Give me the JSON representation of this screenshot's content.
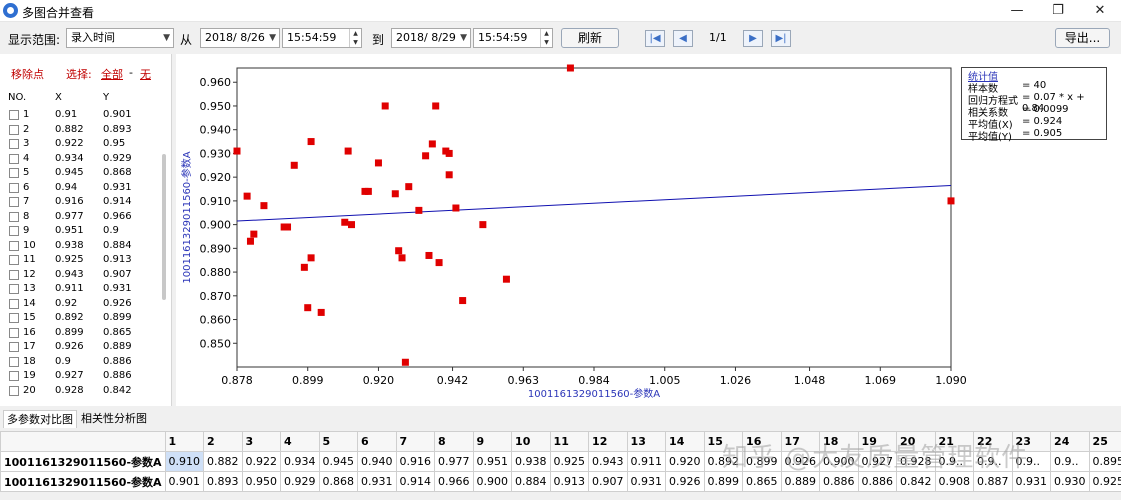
{
  "window": {
    "title": "多图合并查看",
    "controls": [
      "—",
      "❐",
      "✕"
    ]
  },
  "toolbar": {
    "range_label": "显示范围:",
    "range_value": "录入时间",
    "from_label": "从",
    "from_date": "2018/ 8/26",
    "from_time": "15:54:59",
    "to_label": "到",
    "to_date": "2018/ 8/29",
    "to_time": "15:54:59",
    "refresh_label": "刷新",
    "page": "1/1",
    "export_label": "导出..."
  },
  "left_panel": {
    "remove_label": "移除点",
    "select_label": "选择:",
    "all_label": "全部",
    "dash": "-",
    "none_label": "无",
    "columns": [
      "NO.",
      "X",
      "Y"
    ],
    "rows": [
      [
        "1",
        "0.91",
        "0.901"
      ],
      [
        "2",
        "0.882",
        "0.893"
      ],
      [
        "3",
        "0.922",
        "0.95"
      ],
      [
        "4",
        "0.934",
        "0.929"
      ],
      [
        "5",
        "0.945",
        "0.868"
      ],
      [
        "6",
        "0.94",
        "0.931"
      ],
      [
        "7",
        "0.916",
        "0.914"
      ],
      [
        "8",
        "0.977",
        "0.966"
      ],
      [
        "9",
        "0.951",
        "0.9"
      ],
      [
        "10",
        "0.938",
        "0.884"
      ],
      [
        "11",
        "0.925",
        "0.913"
      ],
      [
        "12",
        "0.943",
        "0.907"
      ],
      [
        "13",
        "0.911",
        "0.931"
      ],
      [
        "14",
        "0.92",
        "0.926"
      ],
      [
        "15",
        "0.892",
        "0.899"
      ],
      [
        "16",
        "0.899",
        "0.865"
      ],
      [
        "17",
        "0.926",
        "0.889"
      ],
      [
        "18",
        "0.9",
        "0.886"
      ],
      [
        "19",
        "0.927",
        "0.886"
      ],
      [
        "20",
        "0.928",
        "0.842"
      ]
    ]
  },
  "stats": {
    "title": "统计值",
    "rows": [
      [
        "样本数",
        "= 40"
      ],
      [
        "回归方程式",
        "= 0.07 * x + 0.84"
      ],
      [
        "相关系数",
        "= 0.0099"
      ],
      [
        "平均值(X)",
        "= 0.924"
      ],
      [
        "平均值(Y)",
        "= 0.905"
      ]
    ]
  },
  "tabs": [
    "多参数对比图",
    "相关性分析图"
  ],
  "table": {
    "headers": [
      "1",
      "2",
      "3",
      "4",
      "5",
      "6",
      "7",
      "8",
      "9",
      "10",
      "11",
      "12",
      "13",
      "14",
      "15",
      "16",
      "17",
      "18",
      "19",
      "20",
      "21",
      "22",
      "23",
      "24",
      "25"
    ],
    "rows": [
      {
        "name": "1001161329011560-参数A",
        "values": [
          "0.910",
          "0.882",
          "0.922",
          "0.934",
          "0.945",
          "0.940",
          "0.916",
          "0.977",
          "0.951",
          "0.938",
          "0.925",
          "0.943",
          "0.911",
          "0.920",
          "0.892",
          "0.899",
          "0.926",
          "0.900",
          "0.927",
          "0.928",
          "0.9..",
          "0.9..",
          "0.9..",
          "0.9..",
          "0.895"
        ]
      },
      {
        "name": "1001161329011560-参数A",
        "values": [
          "0.901",
          "0.893",
          "0.950",
          "0.929",
          "0.868",
          "0.931",
          "0.914",
          "0.966",
          "0.900",
          "0.884",
          "0.913",
          "0.907",
          "0.931",
          "0.926",
          "0.899",
          "0.865",
          "0.889",
          "0.886",
          "0.886",
          "0.842",
          "0.908",
          "0.887",
          "0.931",
          "0.930",
          "0.925"
        ]
      }
    ]
  },
  "watermark": "知乎 @大友质量管理软件",
  "colors": {
    "points": "#e00000",
    "regression": "#1010b0",
    "axis_label": "#2b35b8"
  },
  "chart_data": {
    "type": "scatter",
    "xlabel": "1001161329011560-参数A",
    "ylabel": "1001161329011560-参数A",
    "xlim": [
      0.878,
      1.09
    ],
    "ylim": [
      0.84,
      0.966
    ],
    "x_ticks": [
      "0.878",
      "0.899",
      "0.920",
      "0.942",
      "0.963",
      "0.984",
      "1.005",
      "1.026",
      "1.048",
      "1.069",
      "1.090"
    ],
    "y_ticks": [
      "0.850",
      "0.860",
      "0.870",
      "0.880",
      "0.890",
      "0.900",
      "0.910",
      "0.920",
      "0.930",
      "0.940",
      "0.950",
      "0.960"
    ],
    "regression": {
      "slope": 0.07,
      "intercept": 0.84,
      "from": [
        0.878,
        0.9015
      ],
      "to": [
        1.09,
        0.9165
      ]
    },
    "points": [
      [
        0.91,
        0.901
      ],
      [
        0.882,
        0.893
      ],
      [
        0.922,
        0.95
      ],
      [
        0.934,
        0.929
      ],
      [
        0.945,
        0.868
      ],
      [
        0.94,
        0.931
      ],
      [
        0.916,
        0.914
      ],
      [
        0.977,
        0.966
      ],
      [
        0.951,
        0.9
      ],
      [
        0.938,
        0.884
      ],
      [
        0.925,
        0.913
      ],
      [
        0.943,
        0.907
      ],
      [
        0.911,
        0.931
      ],
      [
        0.92,
        0.926
      ],
      [
        0.892,
        0.899
      ],
      [
        0.899,
        0.865
      ],
      [
        0.926,
        0.889
      ],
      [
        0.9,
        0.886
      ],
      [
        0.927,
        0.886
      ],
      [
        0.928,
        0.842
      ],
      [
        0.878,
        0.931
      ],
      [
        0.881,
        0.912
      ],
      [
        0.883,
        0.896
      ],
      [
        0.886,
        0.908
      ],
      [
        0.893,
        0.899
      ],
      [
        0.895,
        0.925
      ],
      [
        0.898,
        0.882
      ],
      [
        0.9,
        0.935
      ],
      [
        0.903,
        0.863
      ],
      [
        0.912,
        0.9
      ],
      [
        0.917,
        0.914
      ],
      [
        0.929,
        0.916
      ],
      [
        0.932,
        0.906
      ],
      [
        0.935,
        0.887
      ],
      [
        0.936,
        0.934
      ],
      [
        0.937,
        0.95
      ],
      [
        0.941,
        0.93
      ],
      [
        0.941,
        0.921
      ],
      [
        0.958,
        0.877
      ],
      [
        1.09,
        0.91
      ]
    ]
  }
}
